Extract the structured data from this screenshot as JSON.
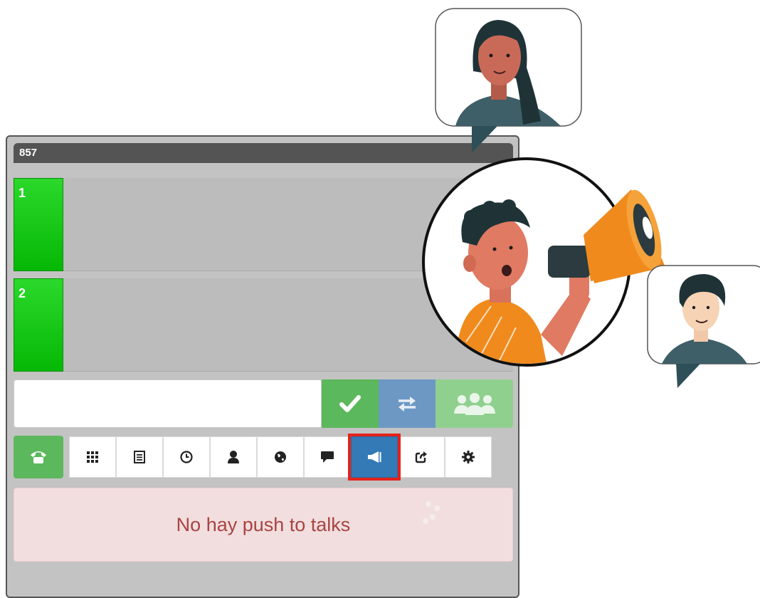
{
  "extension": "857",
  "lines": [
    {
      "number": "1"
    },
    {
      "number": "2"
    }
  ],
  "dialer": {
    "input_value": "",
    "accept_icon": "check-icon",
    "transfer_icon": "transfer-arrows-icon",
    "conference_icon": "conference-users-icon"
  },
  "toolbar": {
    "phone_icon": "phone-icon",
    "tabs": [
      {
        "icon": "keypad-grid-icon"
      },
      {
        "icon": "list-icon"
      },
      {
        "icon": "clock-icon"
      },
      {
        "icon": "contact-user-icon"
      },
      {
        "icon": "globe-icon"
      },
      {
        "icon": "chat-bubble-icon"
      },
      {
        "icon": "megaphone-icon",
        "active": true
      },
      {
        "icon": "share-export-icon"
      },
      {
        "icon": "gear-icon"
      }
    ]
  },
  "alert": {
    "message": "No hay push to talks"
  },
  "colors": {
    "line_green": "#06b806",
    "accept_green": "#5cb85c",
    "transfer_blue": "#6d98c4",
    "active_tab_blue": "#337ab7",
    "highlight_red": "#e5221b",
    "alert_bg": "#f2dede",
    "alert_text": "#a94442"
  }
}
